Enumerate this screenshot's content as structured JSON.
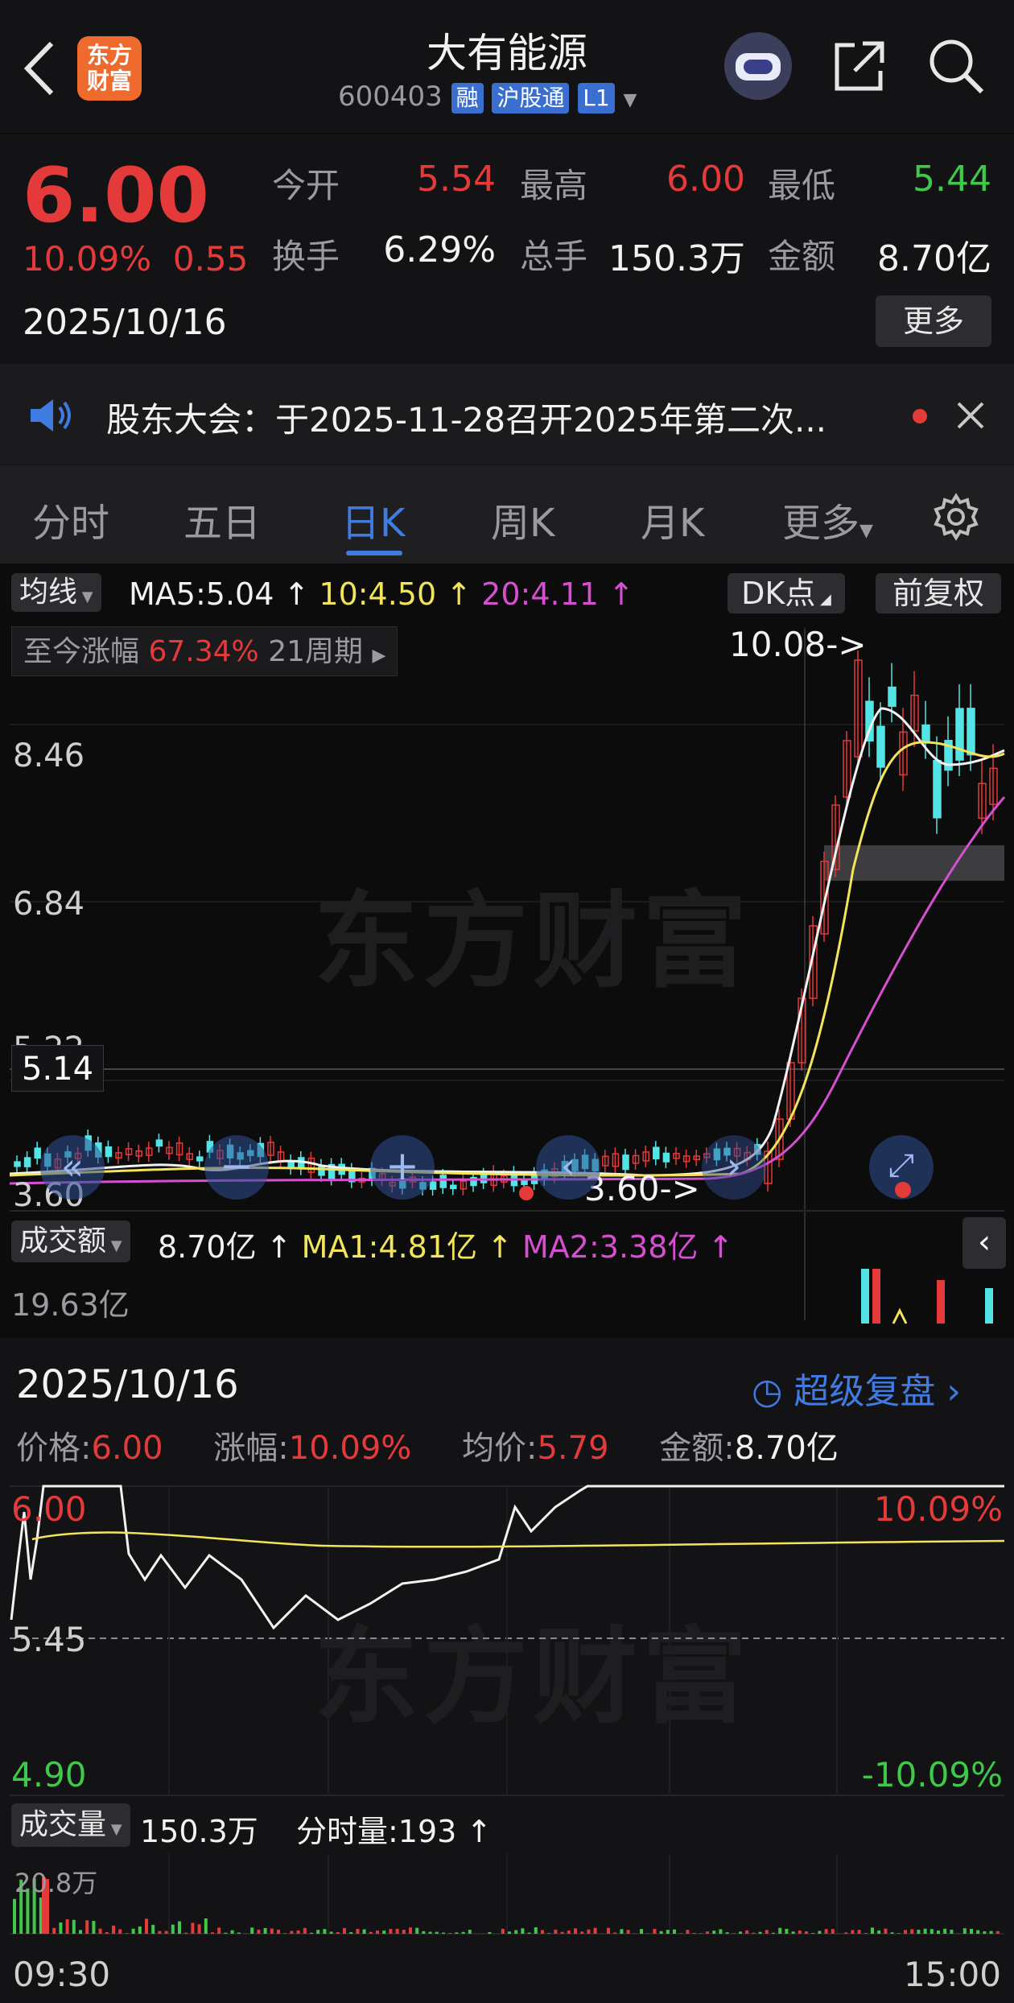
{
  "header": {
    "title": "大有能源",
    "code": "600403",
    "tags": [
      "融",
      "沪股通",
      "L1"
    ],
    "logo_text": [
      "东方",
      "财富"
    ]
  },
  "quote": {
    "price": "6.00",
    "change_pct": "10.09%",
    "change": "0.55",
    "date": "2025/10/16",
    "open_label": "今开",
    "open": "5.54",
    "high_label": "最高",
    "high": "6.00",
    "low_label": "最低",
    "low": "5.44",
    "turnover_label": "换手",
    "turnover": "6.29%",
    "volume_label": "总手",
    "volume": "150.3万",
    "amount_label": "金额",
    "amount": "8.70亿",
    "more": "更多"
  },
  "notice": {
    "text": "股东大会：于2025-11-28召开2025年第二次..."
  },
  "tabs": {
    "items": [
      "分时",
      "五日",
      "日K",
      "周K",
      "月K",
      "更多"
    ],
    "active": "日K"
  },
  "kline": {
    "ma_selector": "均线",
    "ma5": "MA5:5.04 ↑",
    "ma10": "10:4.50 ↑",
    "ma20": "20:4.11 ↑",
    "dk": "DK点",
    "fuquan": "前复权",
    "cum_label": "至今涨幅",
    "cum_value": "67.34%",
    "cum_period": "21周期",
    "y_labels": [
      "8.46",
      "6.84",
      "5.22",
      "3.60"
    ],
    "current_price_label": "5.14",
    "high_marker": "10.08->",
    "low_marker": "3.60->",
    "watermark": "东方财富",
    "vol_selector": "成交额",
    "vol_value": "8.70亿 ↑",
    "vol_ma1": "MA1:4.81亿 ↑",
    "vol_ma2": "MA2:3.38亿 ↑",
    "vol_max": "19.63亿"
  },
  "intraday": {
    "date": "2025/10/16",
    "super_replay": "超级复盘",
    "price_label": "价格:",
    "price": "6.00",
    "chg_label": "涨幅:",
    "chg": "10.09%",
    "avg_label": "均价:",
    "avg": "5.79",
    "amt_label": "金额:",
    "amt": "8.70亿",
    "y_top": "6.00",
    "y_mid": "5.45",
    "y_bot": "4.90",
    "pct_top": "10.09%",
    "pct_bot": "-10.09%",
    "vol_selector": "成交量",
    "vol_value": "150.3万",
    "fen_label": "分时量:193 ↑",
    "vol_max": "20.8万",
    "t_start": "09:30",
    "t_end": "15:00",
    "watermark": "东方财富"
  },
  "colors": {
    "up": "#e43a3a",
    "down": "#3fc84a",
    "ma5": "#f2f2f2",
    "ma10": "#f2e45b",
    "ma20": "#d64fd0",
    "accent": "#3f7be0"
  }
}
